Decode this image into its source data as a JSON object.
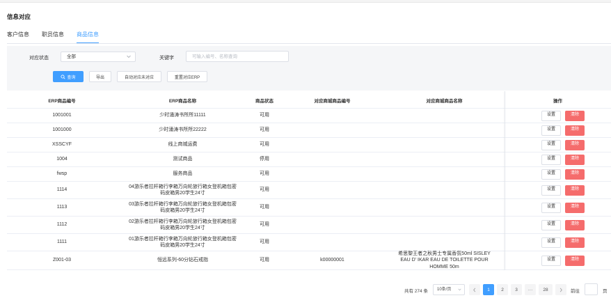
{
  "page": {
    "title": "信息对应"
  },
  "tabs": [
    {
      "label": "客户信息",
      "active": false
    },
    {
      "label": "职员信息",
      "active": false
    },
    {
      "label": "商品信息",
      "active": true
    }
  ],
  "filters": {
    "status_label": "对应状态",
    "status_value": "全部",
    "keyword_label": "关键字",
    "keyword_value": "",
    "keyword_placeholder": "可输入编号、名称查询"
  },
  "buttons": {
    "search": "查询",
    "export": "导出",
    "auto_match": "自动对应未对应",
    "reset_erp": "重置对应ERP"
  },
  "table": {
    "columns": [
      "ERP商品编号",
      "ERP商品名称",
      "商品状态",
      "对应商城商品编号",
      "对应商城商品名称",
      "操作"
    ],
    "action_set": "设置",
    "action_clear": "清除",
    "rows": [
      {
        "code": "1001001",
        "name": "少时涌涛书所所11111",
        "status": "可用",
        "mall_code": "",
        "mall_name": ""
      },
      {
        "code": "1001000",
        "name": "少时涌涛书所所22222",
        "status": "可用",
        "mall_code": "",
        "mall_name": ""
      },
      {
        "code": "XSSCYF",
        "name": "线上商城运费",
        "status": "可用",
        "mall_code": "",
        "mall_name": ""
      },
      {
        "code": "1004",
        "name": "测试商品",
        "status": "停用",
        "mall_code": "",
        "mall_name": ""
      },
      {
        "code": "fwsp",
        "name": "服务商品",
        "status": "可用",
        "mall_code": "",
        "mall_name": ""
      },
      {
        "code": "1114",
        "name": "04游乐者拉杆箱行李箱万向轮旅行箱女登机箱包密码皮箱男20学生24寸",
        "status": "可用",
        "mall_code": "",
        "mall_name": ""
      },
      {
        "code": "1113",
        "name": "03游乐者拉杆箱行李箱万向轮旅行箱女登机箱包密码皮箱男20学生24寸",
        "status": "可用",
        "mall_code": "",
        "mall_name": ""
      },
      {
        "code": "1112",
        "name": "02游乐者拉杆箱行李箱万向轮旅行箱女登机箱包密码皮箱男20学生24寸",
        "status": "可用",
        "mall_code": "",
        "mall_name": ""
      },
      {
        "code": "1111",
        "name": "01游乐者拉杆箱行李箱万向轮旅行箱女登机箱包密码皮箱男20学生24寸",
        "status": "可用",
        "mall_code": "",
        "mall_name": ""
      },
      {
        "code": "Z001-03",
        "name": "恒远系列-60分钻石戒指",
        "status": "可用",
        "mall_code": "k00000001",
        "mall_name": "希思黎王者之秋男士专属香氛50ml SISLEY EAU D' IKAR EAU DE TOILETTE POUR HOMME 50m"
      }
    ]
  },
  "pagination": {
    "total_text": "共有 274 条",
    "page_size": "10条/页",
    "pages": [
      "1",
      "2",
      "3",
      "···",
      "28"
    ],
    "current": "1",
    "goto_label": "前往",
    "page_suffix": "页"
  },
  "colors": {
    "primary": "#409eff",
    "danger": "#f56c6c"
  },
  "icons": [
    "search-icon",
    "chevron-down-icon",
    "chevron-left-icon",
    "chevron-right-icon"
  ]
}
